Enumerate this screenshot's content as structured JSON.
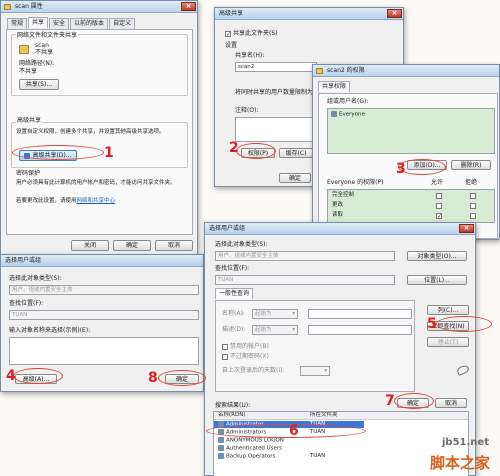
{
  "props": {
    "title": "scan 属性",
    "tabs": [
      "常规",
      "共享",
      "安全",
      "以前的版本",
      "自定义"
    ],
    "sec1": "网络文件和文件夹共享",
    "item_name": "scan",
    "item_status": "不共享",
    "net_path_label": "网络路径(N):",
    "net_path_value": "不共享",
    "share_btn": "共享(S)...",
    "sec2": "高级共享",
    "sec2_desc": "设置自定义权限，创建多个共享，并设置其他高级共享选项。",
    "adv_btn": "高级共享(D)...",
    "sec3": "密码保护",
    "sec3_desc": "用户必须具有此计算机的用户帐户和密码，才能访问共享文件夹。",
    "sec3_link_pre": "若要更改此设置，请使用",
    "sec3_link": "网络和共享中心",
    "close_btn": "关闭",
    "confirm_btn": "确定",
    "cancel_btn": "取消"
  },
  "adv": {
    "title": "高级共享",
    "share_chk": "共享此文件夹(S)",
    "settings": "设置",
    "share_name": "共享名(H):",
    "share_name_value": "scan2",
    "limit": "将同时共享的用户数量限制为",
    "comment": "注释(O):",
    "perm_btn": "权限(P)",
    "cache_btn": "缓存(C)",
    "ok_btn": "确定"
  },
  "perm": {
    "title": "scan2 的权限",
    "tab": "共享权限",
    "group_label": "组或用户名(G):",
    "group_item": "Everyone",
    "add_btn": "添加(D)...",
    "remove_btn": "删除(R)",
    "perm_of": "Everyone 的权限(P)",
    "allow": "允许",
    "deny": "拒绝",
    "rows": [
      {
        "name": "完全控制",
        "allow": "",
        "deny": ""
      },
      {
        "name": "更改",
        "allow": "",
        "deny": ""
      },
      {
        "name": "读取",
        "allow": "✓",
        "deny": ""
      }
    ]
  },
  "sel": {
    "title": "选择用户或组",
    "obj_type_label": "选择此对象类型(S):",
    "obj_type_value": "用户、组或内置安全主体",
    "loc_label": "查找位置(F):",
    "loc_value": "TUAN",
    "names_label": "输入对象名称来选择(示例)(E):",
    "names_link": "示例",
    "adv_btn": "高级(A)...",
    "ok_btn": "确定"
  },
  "sel2": {
    "title": "选择用户或组",
    "obj_type_label": "选择此对象类型(S):",
    "obj_type_value": "用户、组或内置安全主体",
    "obj_type_btn": "对象类型(O)...",
    "loc_label": "查找位置(F):",
    "loc_value": "TUAN",
    "loc_btn": "位置(L)...",
    "query_tab": "一般性查询",
    "name_label": "名称(A):",
    "desc_label": "描述(D):",
    "starts_with": "起始为",
    "disabled_chk": "禁用的帐户(B)",
    "noexp_chk": "不过期密码(X)",
    "days_label": "自上次登录后的天数(I):",
    "col_btn": "列(C)...",
    "find_btn": "立即查找(N)",
    "stop_btn": "停止(T)",
    "ok_btn": "确定",
    "cancel_btn": "取消",
    "results_label": "搜索结果(U):",
    "col_name": "名称(RDN)",
    "col_folder": "所在文件夹",
    "results": [
      {
        "name": "Administrator",
        "folder": "TUAN"
      },
      {
        "name": "Administrators",
        "folder": "TUAN"
      },
      {
        "name": "ANONYMOUS LOGON",
        "folder": ""
      },
      {
        "name": "Authenticated Users",
        "folder": ""
      },
      {
        "name": "Backup Operators",
        "folder": "TUAN"
      }
    ]
  },
  "steps": {
    "s1": "1",
    "s2": "2",
    "s3": "3",
    "s4": "4",
    "s5": "5",
    "s6": "6",
    "s7": "7",
    "s8": "8"
  },
  "watermark": {
    "site": "jb51.net",
    "brand": "脚本之家"
  },
  "colors": {
    "step_red": "#e21f1f",
    "selected_blue": "#3a78d8",
    "list_green": "#d8ecd5"
  }
}
